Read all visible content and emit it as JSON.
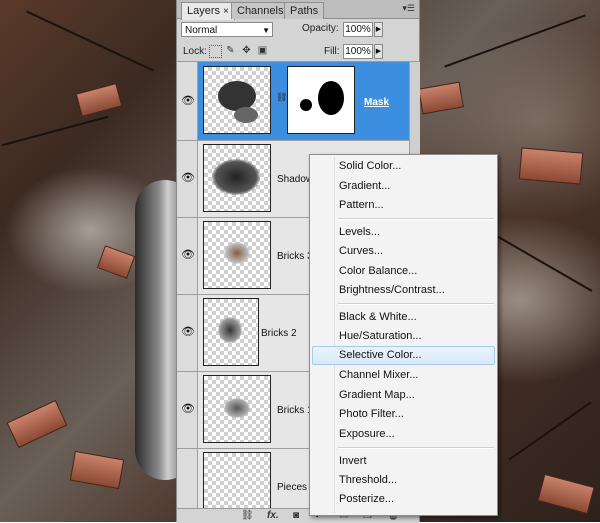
{
  "tabs": [
    {
      "label": "Layers",
      "close": "×"
    },
    {
      "label": "Channels"
    },
    {
      "label": "Paths"
    }
  ],
  "blend_mode": "Normal",
  "opacity": {
    "label": "Opacity:",
    "value": "100%"
  },
  "lock": {
    "label": "Lock:"
  },
  "fill": {
    "label": "Fill:",
    "value": "100%"
  },
  "layers": [
    {
      "name": "",
      "mask_label": "Mask",
      "selected": true,
      "visible": true
    },
    {
      "name": "Shadow",
      "visible": true
    },
    {
      "name": "Bricks 3",
      "visible": true
    },
    {
      "name": "Bricks 2",
      "visible": true
    },
    {
      "name": "Bricks 1",
      "visible": true
    },
    {
      "name": "Pieces 3",
      "visible": false
    }
  ],
  "adjustment_menu": {
    "items": [
      "Solid Color...",
      "Gradient...",
      "Pattern...",
      "Levels...",
      "Curves...",
      "Color Balance...",
      "Brightness/Contrast...",
      "Black & White...",
      "Hue/Saturation...",
      "Selective Color...",
      "Channel Mixer...",
      "Gradient Map...",
      "Photo Filter...",
      "Exposure...",
      "Invert",
      "Threshold...",
      "Posterize..."
    ],
    "highlighted": "Selective Color..."
  },
  "icons": {
    "eye": "eye-icon",
    "link": "link-icon",
    "fx": "fx-icon",
    "mask": "add-mask-icon",
    "adjustment": "adjustment-layer-icon",
    "group": "group-icon",
    "new_layer": "new-layer-icon",
    "trash": "trash-icon"
  },
  "colors": {
    "selection": "#3c8fe0",
    "menu_highlight": "#d9e9f8"
  }
}
